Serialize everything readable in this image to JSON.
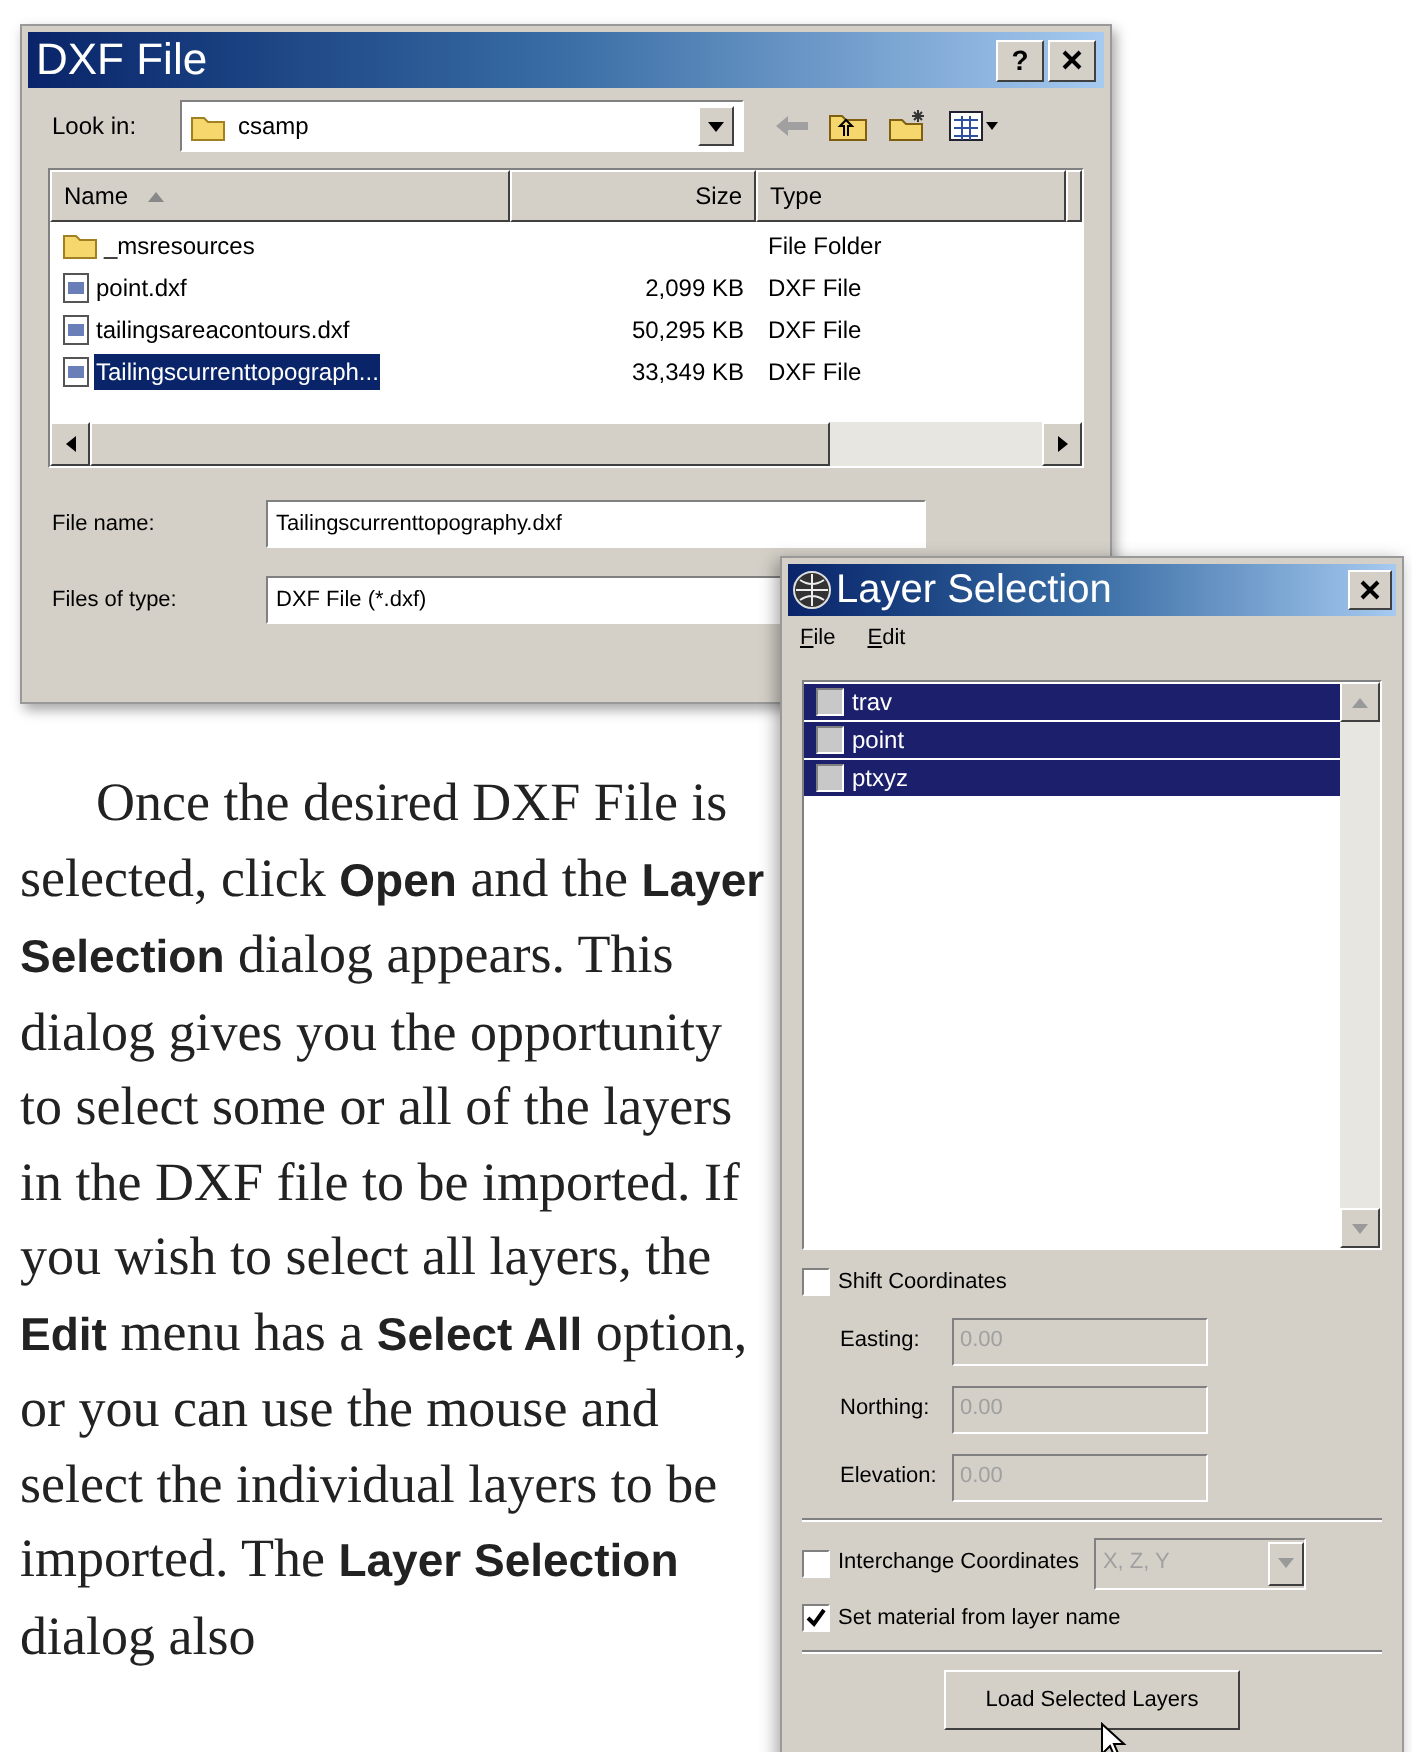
{
  "file_dialog": {
    "title": "DXF File",
    "help_button": "?",
    "look_in": {
      "label": "Look in:",
      "value": "csamp"
    },
    "columns": [
      "Name",
      "Size",
      "Type"
    ],
    "files": [
      {
        "name": "_msresources",
        "type": "File Folder",
        "kind": "folder",
        "selected": false
      },
      {
        "name": "point.dxf",
        "size": "2,099 KB",
        "type": "DXF File",
        "kind": "file",
        "selected": false
      },
      {
        "name": "tailingsareacontours.dxf",
        "size": "50,295 KB",
        "type": "DXF File",
        "kind": "file",
        "selected": false
      },
      {
        "name": "Tailingscurrenttopograph...",
        "size": "33,349 KB",
        "type": "DXF File",
        "kind": "file",
        "selected": true
      }
    ],
    "file_name": {
      "label": "File name:",
      "value": "Tailingscurrenttopography.dxf"
    },
    "file_type": {
      "label": "Files of type:",
      "value": "DXF File (*.dxf)"
    }
  },
  "layer_dialog": {
    "title": "Layer Selection",
    "menu": [
      "File",
      "Edit"
    ],
    "layers": [
      {
        "name": "trav",
        "selected": true,
        "checked": false
      },
      {
        "name": "point",
        "selected": true,
        "checked": false
      },
      {
        "name": "ptxyz",
        "selected": true,
        "checked": false
      }
    ],
    "shift_coordinates": {
      "label": "Shift Coordinates",
      "checked": false
    },
    "fields": [
      {
        "label": "Easting:",
        "value": "0.00",
        "disabled": true
      },
      {
        "label": "Northing:",
        "value": "0.00",
        "disabled": true
      },
      {
        "label": "Elevation:",
        "value": "0.00",
        "disabled": true
      }
    ],
    "interchange": {
      "label": "Interchange Coordinates",
      "checked": false,
      "value": "X, Z, Y",
      "disabled": true
    },
    "set_material": {
      "label": "Set material from layer name",
      "checked": true
    },
    "load_button": "Load Selected Layers"
  },
  "paragraph": "Once the desired DXF File is selected, click **Open** and the **Layer Selection** dialog appears. This dialog gives you the opportunity to select some or all of the layers in the DXF file to be imported. If you wish to select all layers, the **Edit** menu has a **Select All** option, or you can use the mouse and select the individual layers to be imported. The **Layer Selection** dialog also"
}
